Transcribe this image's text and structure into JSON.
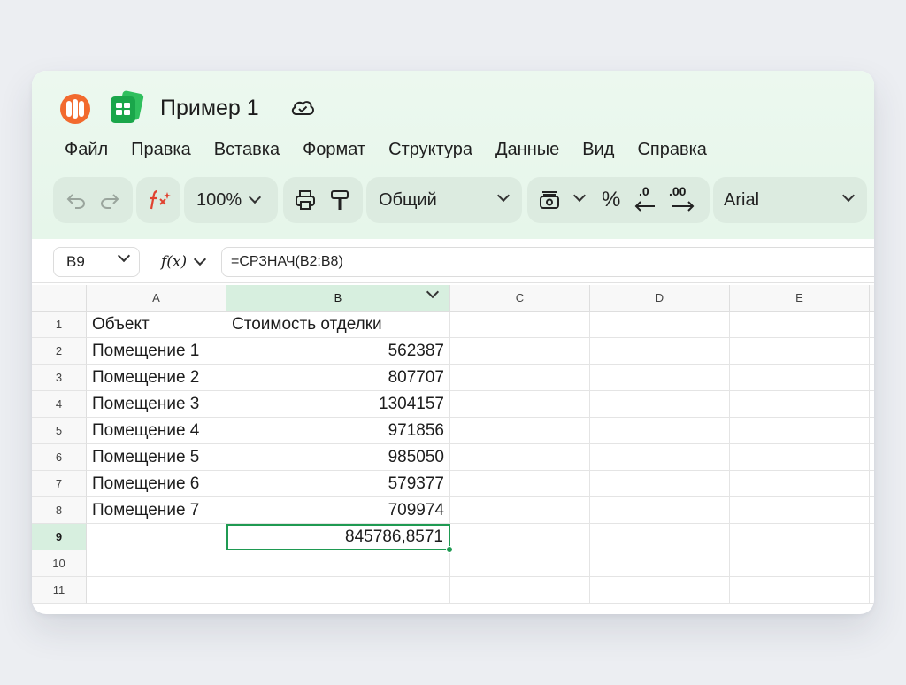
{
  "app": {
    "doc_title": "Пример 1",
    "logo_icon": "yandex-360-logo",
    "app_icon": "tables-app-icon",
    "sync_icon": "cloud-check-icon",
    "accent_color": "#1f9a52"
  },
  "menu": [
    "Файл",
    "Правка",
    "Вставка",
    "Формат",
    "Структура",
    "Данные",
    "Вид",
    "Справка"
  ],
  "toolbar": {
    "undo_icon": "undo-icon",
    "redo_icon": "redo-icon",
    "functions_icon": "function-magic-icon",
    "zoom": "100%",
    "print_icon": "print-icon",
    "paint_format_icon": "paint-roller-icon",
    "number_format": "Общий",
    "currency_icon": "currency-icon",
    "percent_label": "%",
    "decrease_decimals_label": ".0",
    "increase_decimals_label": ".00",
    "font": "Arial"
  },
  "formula_bar": {
    "name_box": "B9",
    "fx_label": "f(x)",
    "formula": "=СРЗНАЧ(B2:B8)"
  },
  "sheet": {
    "columns": [
      "A",
      "B",
      "C",
      "D",
      "E"
    ],
    "selected_column": "B",
    "selected_row": "9",
    "rows": [
      {
        "num": "1",
        "a": "Объект",
        "b": "Стоимость отделки"
      },
      {
        "num": "2",
        "a": "Помещение 1",
        "b": "562387"
      },
      {
        "num": "3",
        "a": "Помещение 2",
        "b": "807707"
      },
      {
        "num": "4",
        "a": "Помещение 3",
        "b": "1304157"
      },
      {
        "num": "5",
        "a": "Помещение 4",
        "b": "971856"
      },
      {
        "num": "6",
        "a": "Помещение 5",
        "b": "985050"
      },
      {
        "num": "7",
        "a": "Помещение 6",
        "b": "579377"
      },
      {
        "num": "8",
        "a": "Помещение 7",
        "b": "709974"
      },
      {
        "num": "9",
        "a": "",
        "b": "845786,8571"
      },
      {
        "num": "10",
        "a": "",
        "b": ""
      },
      {
        "num": "11",
        "a": "",
        "b": ""
      }
    ]
  }
}
